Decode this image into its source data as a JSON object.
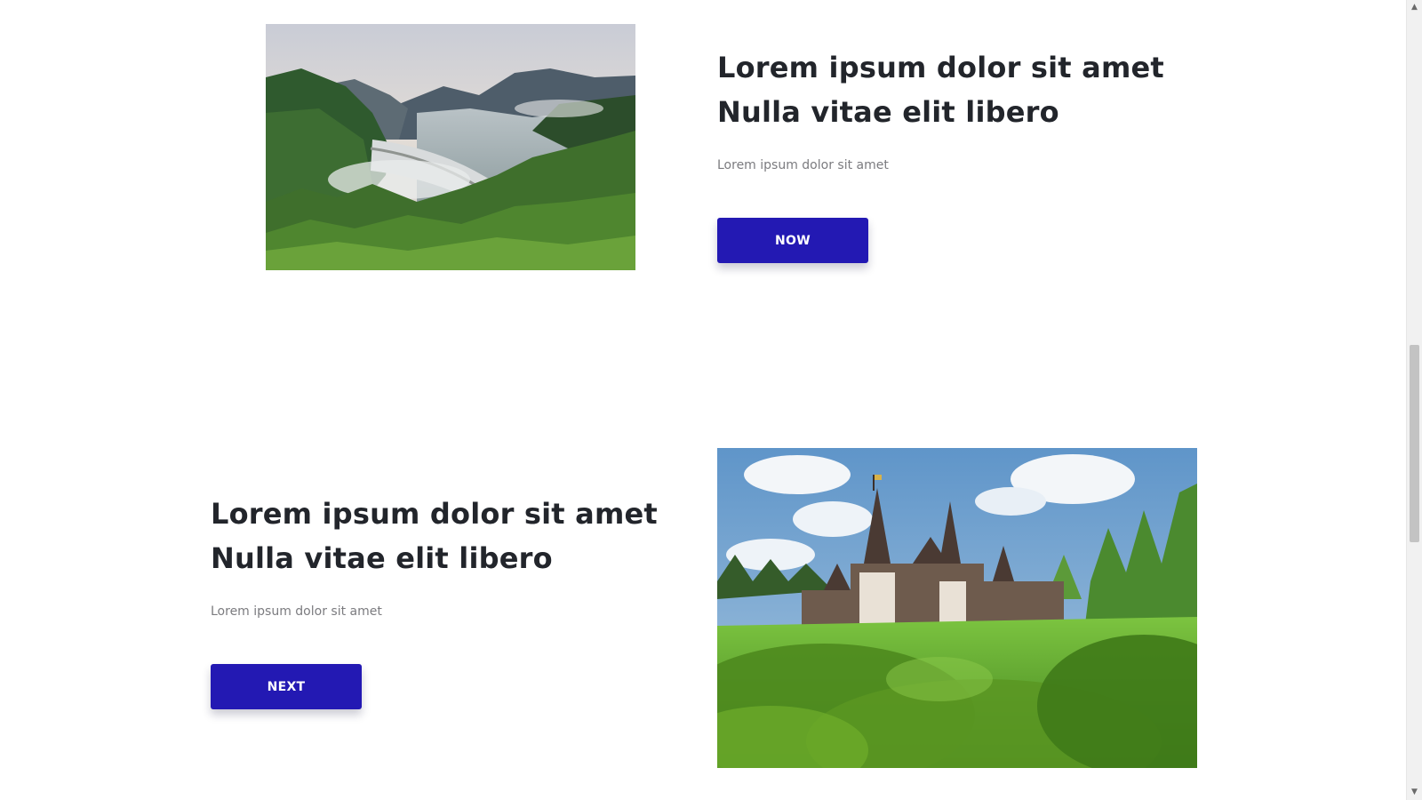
{
  "features": [
    {
      "heading_line1": "Lorem ipsum dolor sit amet",
      "heading_line2": "Nulla vitae elit libero",
      "text": "Lorem ipsum dolor sit amet",
      "button_label": "NOW",
      "image": "mountain-lake-dam-photo"
    },
    {
      "heading_line1": "Lorem ipsum dolor sit amet",
      "heading_line2": "Nulla vitae elit libero",
      "text": "Lorem ipsum dolor sit amet",
      "button_label": "NEXT",
      "image": "castle-photo"
    }
  ],
  "scrollbar": {
    "up_icon": "arrow-up-icon",
    "down_icon": "arrow-down-icon"
  },
  "colors": {
    "button": "#2319b3",
    "heading": "#22252b",
    "subtext": "#7b7b7f"
  }
}
